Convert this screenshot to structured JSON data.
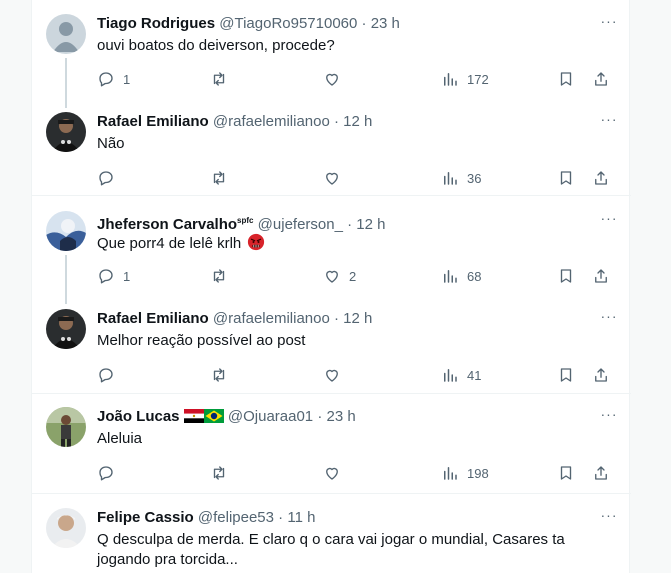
{
  "posts": [
    {
      "name": "Tiago Rodrigues",
      "handle": "@TiagoRo95710060",
      "time": "· 23 h",
      "text": "ouvi boatos do deiverson, procede?",
      "replies": "1",
      "retweets": "",
      "likes": "",
      "views": "172",
      "avatar": "default-gray"
    },
    {
      "name": "Rafael Emiliano",
      "handle": "@rafaelemilianoo",
      "time": "· 12 h",
      "text": "Não",
      "replies": "",
      "retweets": "",
      "likes": "",
      "views": "36",
      "avatar": "photo-dark"
    },
    {
      "name": "Jheferson Carvalho",
      "name_badge": "spfc",
      "handle": "@ujeferson_",
      "time": "· 12 h",
      "text": "Que porr4 de lelê krlh",
      "text_emoji": "angry-face",
      "replies": "1",
      "retweets": "",
      "likes": "2",
      "views": "68",
      "avatar": "photo-blue"
    },
    {
      "name": "Rafael Emiliano",
      "handle": "@rafaelemilianoo",
      "time": "· 12 h",
      "text": "Melhor reação possível ao post",
      "replies": "",
      "retweets": "",
      "likes": "",
      "views": "41",
      "avatar": "photo-dark"
    },
    {
      "name": "João Lucas",
      "flags": [
        "egypt-flag",
        "brazil-flag"
      ],
      "handle": "@Ojuaraa01",
      "time": "· 23 h",
      "text": "Aleluia",
      "replies": "",
      "retweets": "",
      "likes": "",
      "views": "198",
      "avatar": "photo-outdoor"
    },
    {
      "name": "Felipe Cassio",
      "handle": "@felipee53",
      "time": "· 11 h",
      "text_line1": "Q desculpa de merda. E claro q o cara vai jogar o mundial, Casares ta",
      "text_line2": "jogando pra torcida...",
      "avatar": "photo-light"
    }
  ],
  "colors": {
    "text": "#0f1419",
    "secondary": "#536471",
    "divider": "#eff3f4",
    "thread": "#cfd9de"
  },
  "icons": [
    "reply-icon",
    "retweet-icon",
    "like-icon",
    "views-icon",
    "bookmark-icon",
    "share-icon",
    "more-icon"
  ]
}
